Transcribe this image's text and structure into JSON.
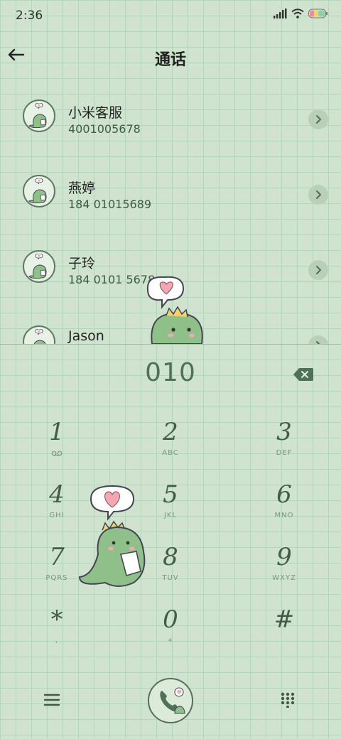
{
  "status_bar": {
    "time": "2:36",
    "icons": [
      "signal-icon",
      "wifi-icon",
      "battery-icon"
    ]
  },
  "header": {
    "title": "通话",
    "back_icon": "arrow-left-icon"
  },
  "contacts": [
    {
      "name": "小米客服",
      "number": "4001005678"
    },
    {
      "name": "燕婷",
      "number": "184 01015689"
    },
    {
      "name": "子玲",
      "number": "184 0101 5678"
    },
    {
      "name": "Jason",
      "number": ""
    }
  ],
  "dialer": {
    "input": "010",
    "backspace_icon": "backspace-icon"
  },
  "keypad": [
    {
      "digit": "1",
      "letters": ""
    },
    {
      "digit": "2",
      "letters": "ABC"
    },
    {
      "digit": "3",
      "letters": "DEF"
    },
    {
      "digit": "4",
      "letters": "GHI"
    },
    {
      "digit": "5",
      "letters": "JKL"
    },
    {
      "digit": "6",
      "letters": "MNO"
    },
    {
      "digit": "7",
      "letters": "PQRS"
    },
    {
      "digit": "8",
      "letters": "TUV"
    },
    {
      "digit": "9",
      "letters": "WXYZ"
    },
    {
      "digit": "*",
      "letters": ","
    },
    {
      "digit": "0",
      "letters": "+"
    },
    {
      "digit": "#",
      "letters": ""
    }
  ],
  "bottom_bar": {
    "menu_icon": "menu-icon",
    "call_icon": "phone-icon",
    "keypad_icon": "dialpad-icon"
  },
  "colors": {
    "background": "#cfe3cf",
    "grid_line": "#b5d4b9",
    "accent": "#4f7157",
    "dino_green": "#8fc08a"
  }
}
